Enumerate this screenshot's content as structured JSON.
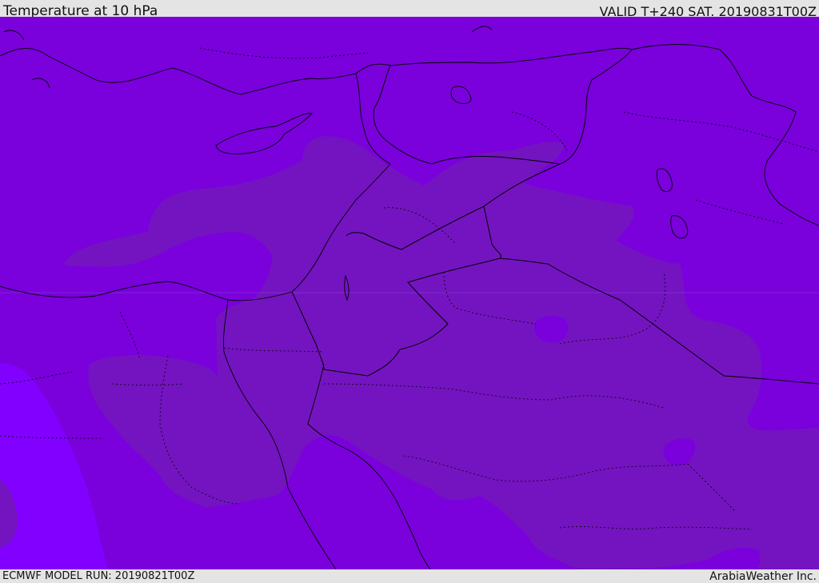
{
  "header": {
    "title": "Temperature at 10 hPa",
    "valid": "VALID T+240 SAT. 20190831T00Z"
  },
  "footer": {
    "model_run": "ECMWF MODEL RUN: 20190821T00Z",
    "credit": "ArabiaWeather Inc."
  },
  "map": {
    "fill_colors": {
      "base": "#7a00dc",
      "warmer_zone": "#7414c0",
      "colder_zone": "#8200ff"
    },
    "line_color": "#000000"
  }
}
